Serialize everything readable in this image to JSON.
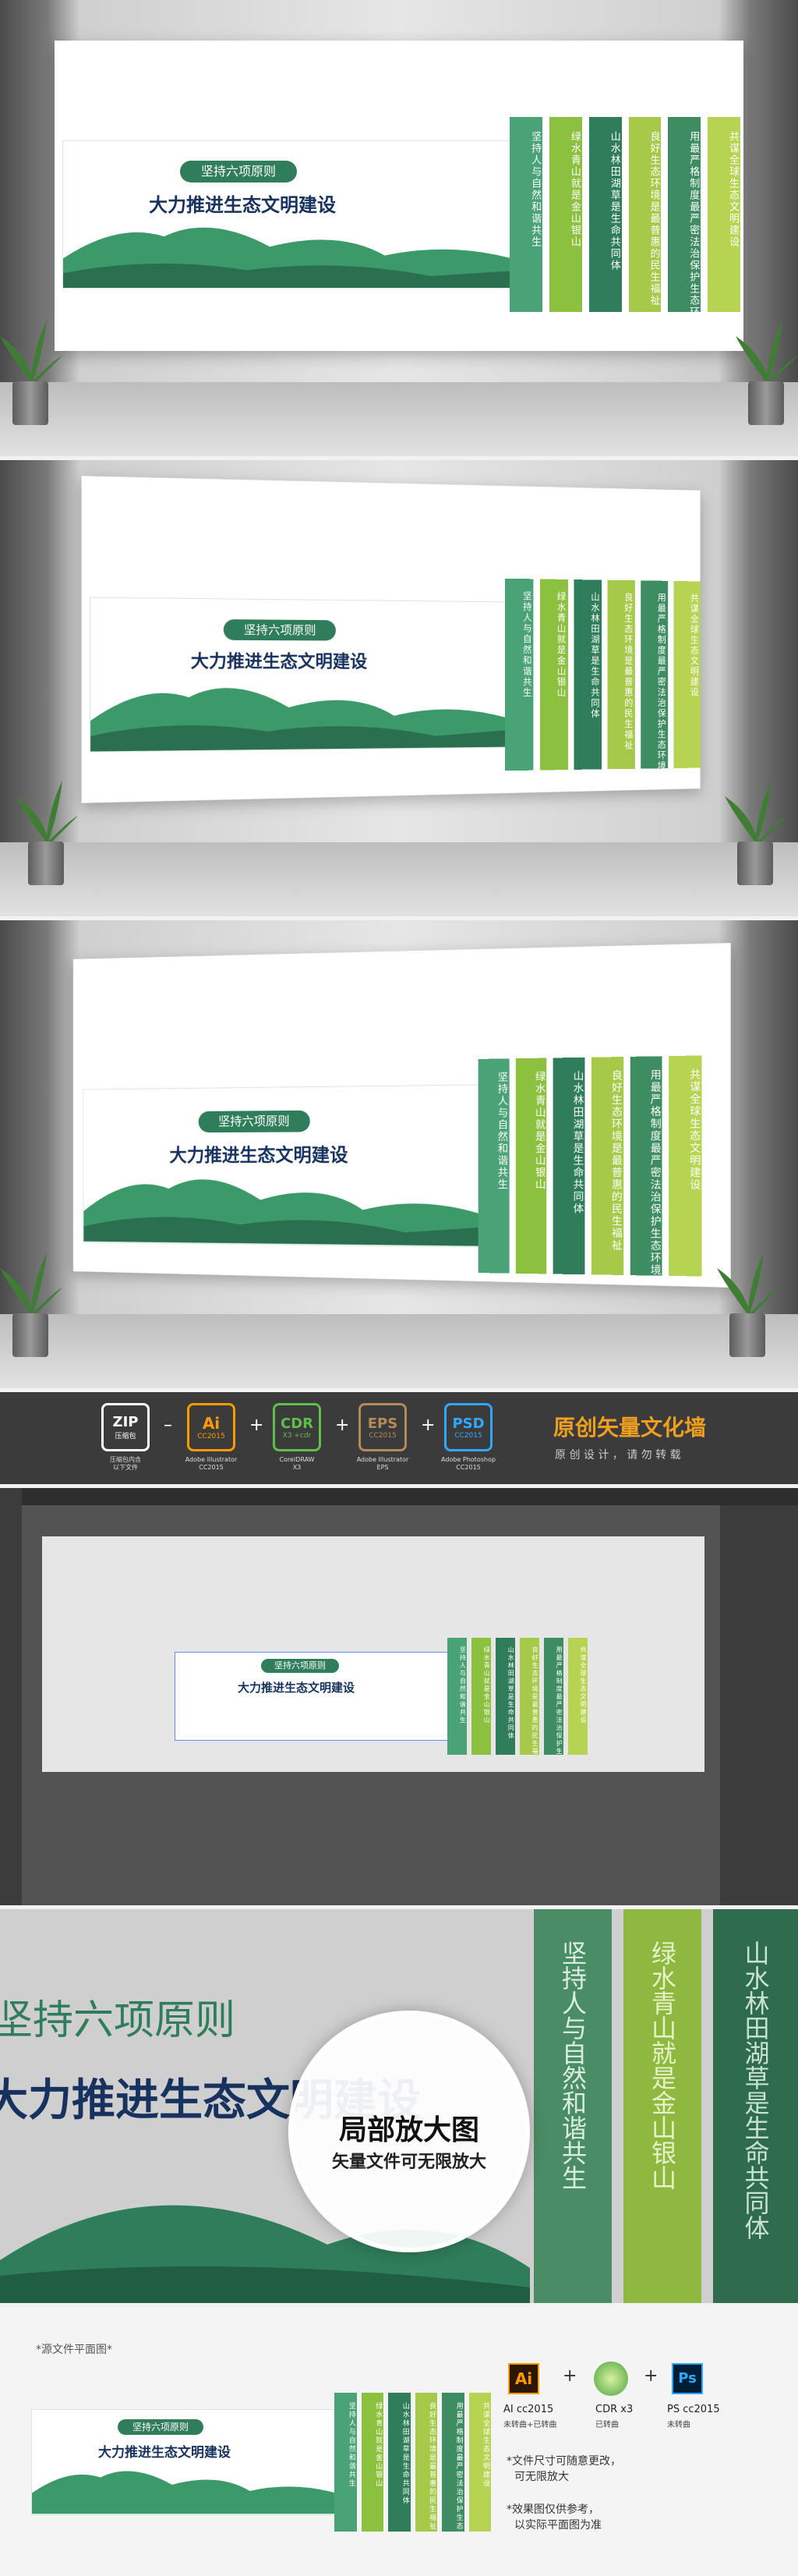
{
  "design": {
    "title_small": "坚持六项原则",
    "title_big": "大力推进生态文明建设",
    "strips": [
      {
        "text": "坚持人与自然和谐共生",
        "color": "#4aa277"
      },
      {
        "text": "绿水青山就是金山银山",
        "color": "#8cc03f"
      },
      {
        "text": "山水林田湖草是生命共同体",
        "color": "#2f7d5b"
      },
      {
        "text": "良好生态环境是最普惠的民生福祉",
        "color": "#a6c94a"
      },
      {
        "text": "用最严格制度最严密法治保护生态环境",
        "color": "#3d8c62"
      },
      {
        "text": "共谋全球生态文明建设",
        "color": "#b6d451"
      }
    ]
  },
  "software_bar": {
    "zip": {
      "title": "ZIP",
      "sub": "压缩包",
      "label": "压缩包内含\n以下文件"
    },
    "ai": {
      "title": "Ai",
      "ver": "CC2015",
      "label": "Adobe Illustrator\nCC2015"
    },
    "cdr": {
      "title": "CDR",
      "ver": "X3 +cdr",
      "label": "CorelDRAW\nX3"
    },
    "eps": {
      "title": "EPS",
      "ver": "CC2015",
      "label": "Adobe Illustrator\nEPS"
    },
    "psd": {
      "title": "PSD",
      "ver": "CC2015",
      "label": "Adobe Photoshop\nCC2015"
    },
    "headline": "原创矢量文化墙",
    "subline": "原 创 设 计 ， 请 勿 转 载"
  },
  "zoom": {
    "circle_title": "局部放大图",
    "circle_sub": "矢量文件可无限放大",
    "large_title1": "坚持六项原则",
    "large_title2": "大力推进生态文明建设",
    "strips": [
      "坚持人与自然和谐共生",
      "绿水青山就是金山银山",
      "山水林田湖草是生命共同体"
    ]
  },
  "flat": {
    "header": "*源文件平面图*",
    "ai_label": "AI cc2015",
    "ai_sub": "未转曲+已转曲",
    "cdr_label": "CDR x3",
    "cdr_sub": "已转曲",
    "ps_label": "PS cc2015",
    "ps_sub": "未转曲",
    "note1_a": "*文件尺寸可随意更改，",
    "note1_b": "可无限放大",
    "note2_a": "*效果图仅供参考，",
    "note2_b": "以实际平面图为准"
  }
}
